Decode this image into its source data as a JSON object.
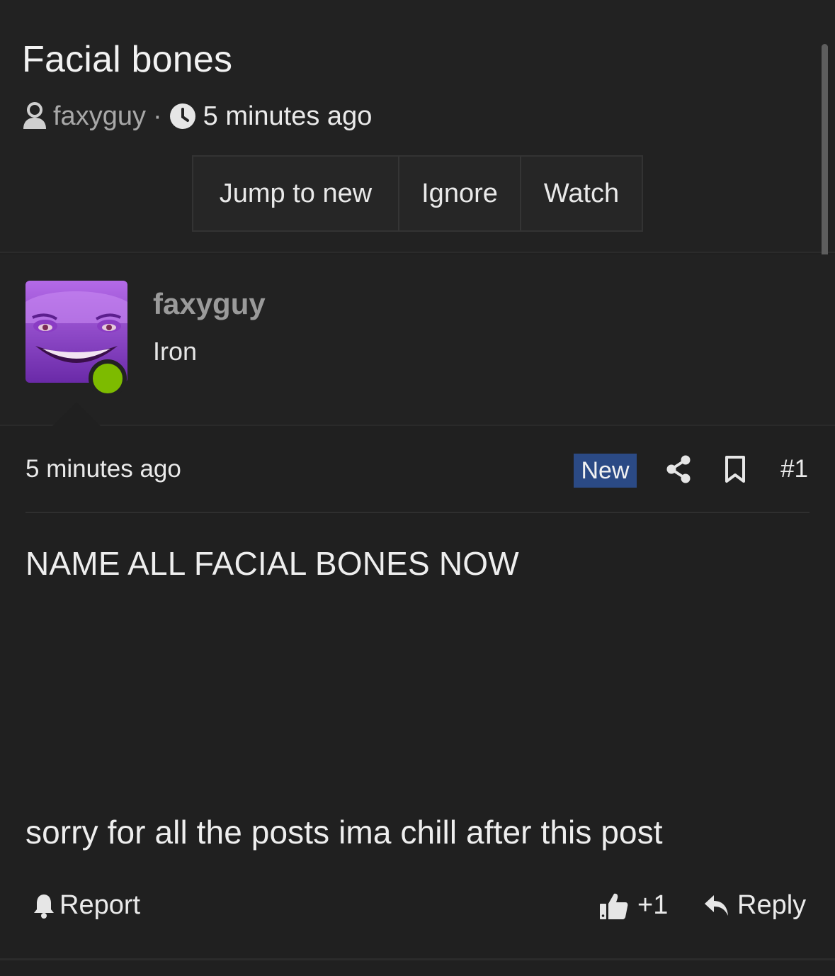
{
  "thread": {
    "title": "Facial bones",
    "author": "faxyguy",
    "separator": "·",
    "time": "5 minutes ago",
    "buttons": {
      "jump_to_new": "Jump to new",
      "ignore": "Ignore",
      "watch": "Watch"
    }
  },
  "post": {
    "author": {
      "name": "faxyguy",
      "rank": "Iron",
      "online": true,
      "avatar_icon": "purple-cartoon-face"
    },
    "time": "5 minutes ago",
    "badge": "New",
    "number": "#1",
    "body_line1": "NAME ALL FACIAL BONES NOW",
    "body_line2": "sorry for all the posts ima chill after this post",
    "actions": {
      "report": "Report",
      "like_count": "+1",
      "reply": "Reply"
    }
  },
  "colors": {
    "background": "#202020",
    "badge": "#2b4a85",
    "online": "#7dbb00",
    "muted_text": "#a8a8a8"
  }
}
